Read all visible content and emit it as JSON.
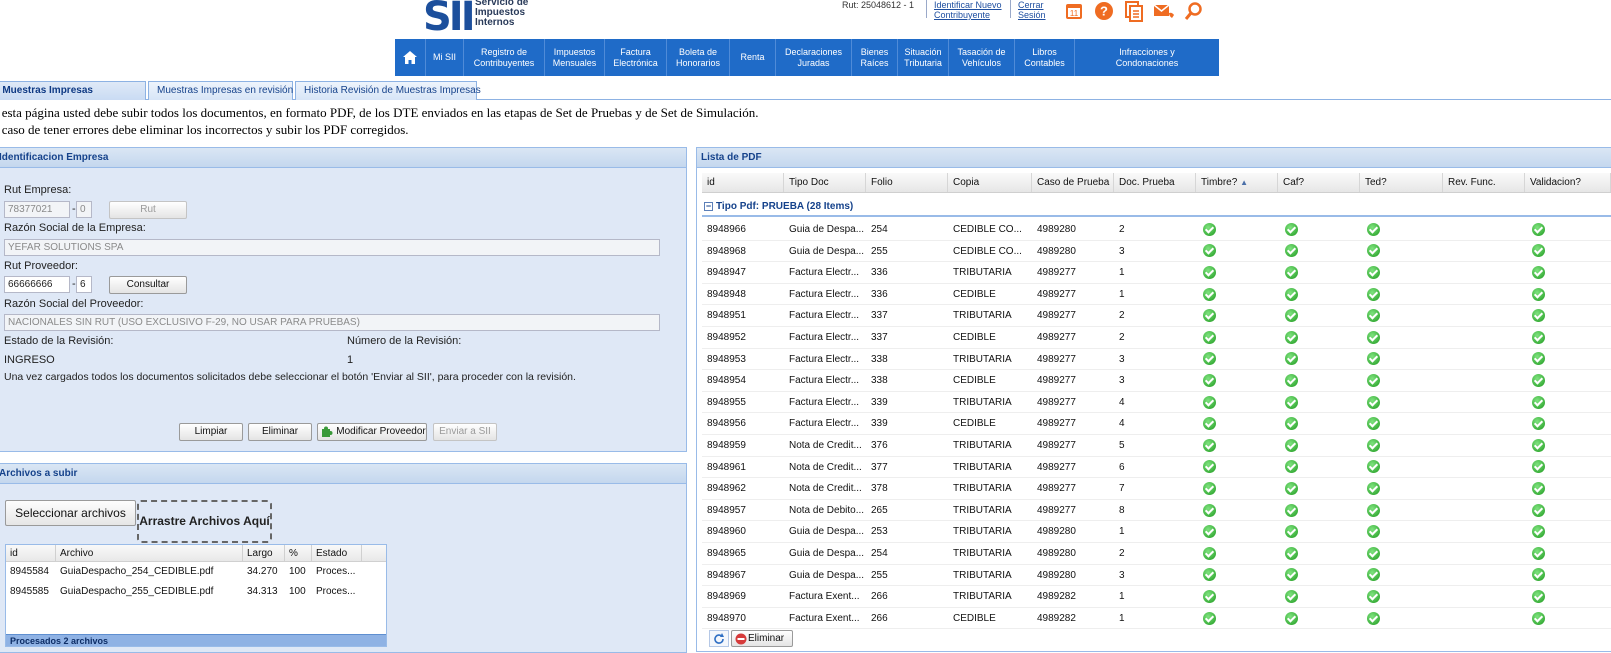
{
  "header": {
    "logo_mark": "SII",
    "logo_text": [
      "Servicio de",
      "Impuestos",
      "Internos"
    ],
    "rut_label": "Rut: 25048612 - 1",
    "link_identificar": [
      "Identificar Nuevo",
      "Contribuyente"
    ],
    "link_cerrar": [
      "Cerrar",
      "Sesión"
    ],
    "calendar_day": "11",
    "icons": [
      "calendar-icon",
      "help-icon",
      "documents-icon",
      "mail-phone-icon",
      "search-icon"
    ]
  },
  "nav": [
    {
      "label": [
        "",
        ""
      ],
      "icon": "home-icon"
    },
    {
      "label": [
        "Mi SII",
        ""
      ]
    },
    {
      "label": [
        "Registro de",
        "Contribuyentes"
      ]
    },
    {
      "label": [
        "Impuestos",
        "Mensuales"
      ]
    },
    {
      "label": [
        "Factura",
        "Electrónica"
      ]
    },
    {
      "label": [
        "Boleta de",
        "Honorarios"
      ]
    },
    {
      "label": [
        "Renta",
        ""
      ]
    },
    {
      "label": [
        "Declaraciones",
        "Juradas"
      ]
    },
    {
      "label": [
        "Bienes",
        "Raíces"
      ]
    },
    {
      "label": [
        "Situación",
        "Tributaria"
      ]
    },
    {
      "label": [
        "Tasación de",
        "Vehículos"
      ]
    },
    {
      "label": [
        "Libros",
        "Contables"
      ]
    },
    {
      "label": [
        "Infracciones y",
        "Condonaciones"
      ]
    }
  ],
  "tabs": [
    {
      "label": "Ingreso de Muestras Impresas",
      "active": true
    },
    {
      "label": "Muestras Impresas en revisión",
      "active": false
    },
    {
      "label": "Historia Revisión de Muestras Impresas",
      "active": false
    }
  ],
  "intro": [
    "En esta página usted debe subir todos los documentos, en formato PDF, de los DTE enviados en las etapas de Set de Pruebas y de Set de Simulación.",
    "En caso de tener errores debe eliminar los incorrectos y subir los PDF corregidos."
  ],
  "empresa_panel": {
    "title": "Identificacion Empresa",
    "rut_empresa_label": "Rut Empresa:",
    "rut_empresa_value": "78377021",
    "rut_empresa_dv": "0",
    "rut_button": "Rut",
    "razon_social_label": "Razón Social de la Empresa:",
    "razon_social_value": "YEFAR SOLUTIONS SPA",
    "rut_proveedor_label": "Rut Proveedor:",
    "rut_proveedor_value": "66666666",
    "rut_proveedor_dv": "6",
    "consultar_button": "Consultar",
    "razon_proveedor_label": "Razón Social del Proveedor:",
    "razon_proveedor_value": "NACIONALES SIN RUT   (USO EXCLUSIVO F-29, NO USAR PARA PRUEBAS)",
    "estado_label": "Estado de la Revisión:",
    "estado_value": "INGRESO",
    "numero_label": "Número de la Revisión:",
    "numero_value": "1",
    "note": "Una vez cargados todos los documentos solicitados debe seleccionar el botón 'Enviar al SII', para proceder con la revisión.",
    "buttons": {
      "limpiar": "Limpiar",
      "eliminar": "Eliminar",
      "modificar": "Modificar Proveedor",
      "enviar": "Enviar a SII"
    }
  },
  "archivos_panel": {
    "title": "Archivos a subir",
    "select_button": "Seleccionar archivos",
    "drop_zone": "Arrastre Archivos Aquí",
    "columns": [
      "id",
      "Archivo",
      "Largo",
      "%",
      "Estado"
    ],
    "rows": [
      [
        "8945584",
        "GuiaDespacho_254_CEDIBLE.pdf",
        "34.270",
        "100",
        "Proces..."
      ],
      [
        "8945585",
        "GuiaDespacho_255_CEDIBLE.pdf",
        "34.313",
        "100",
        "Proces..."
      ]
    ],
    "footer": "Procesados 2 archivos"
  },
  "pdf_panel": {
    "title": "Lista de PDF",
    "columns": [
      "id",
      "Tipo Doc",
      "Folio",
      "Copia",
      "Caso de Prueba",
      "Doc. Prueba",
      "Timbre?",
      "Caf?",
      "Ted?",
      "Rev. Func.",
      "Validacion?"
    ],
    "group": "Tipo Pdf: PRUEBA (28 Items)",
    "rows": [
      [
        "8948966",
        "Guia de Despa...",
        "254",
        "CEDIBLE CO...",
        "4989280",
        "2"
      ],
      [
        "8948968",
        "Guia de Despa...",
        "255",
        "CEDIBLE CO...",
        "4989280",
        "3"
      ],
      [
        "8948947",
        "Factura Electr...",
        "336",
        "TRIBUTARIA",
        "4989277",
        "1"
      ],
      [
        "8948948",
        "Factura Electr...",
        "336",
        "CEDIBLE",
        "4989277",
        "1"
      ],
      [
        "8948951",
        "Factura Electr...",
        "337",
        "TRIBUTARIA",
        "4989277",
        "2"
      ],
      [
        "8948952",
        "Factura Electr...",
        "337",
        "CEDIBLE",
        "4989277",
        "2"
      ],
      [
        "8948953",
        "Factura Electr...",
        "338",
        "TRIBUTARIA",
        "4989277",
        "3"
      ],
      [
        "8948954",
        "Factura Electr...",
        "338",
        "CEDIBLE",
        "4989277",
        "3"
      ],
      [
        "8948955",
        "Factura Electr...",
        "339",
        "TRIBUTARIA",
        "4989277",
        "4"
      ],
      [
        "8948956",
        "Factura Electr...",
        "339",
        "CEDIBLE",
        "4989277",
        "4"
      ],
      [
        "8948959",
        "Nota de Credit...",
        "376",
        "TRIBUTARIA",
        "4989277",
        "5"
      ],
      [
        "8948961",
        "Nota de Credit...",
        "377",
        "TRIBUTARIA",
        "4989277",
        "6"
      ],
      [
        "8948962",
        "Nota de Credit...",
        "378",
        "TRIBUTARIA",
        "4989277",
        "7"
      ],
      [
        "8948957",
        "Nota de Debito...",
        "265",
        "TRIBUTARIA",
        "4989277",
        "8"
      ],
      [
        "8948960",
        "Guia de Despa...",
        "253",
        "TRIBUTARIA",
        "4989280",
        "1"
      ],
      [
        "8948965",
        "Guia de Despa...",
        "254",
        "TRIBUTARIA",
        "4989280",
        "2"
      ],
      [
        "8948967",
        "Guia de Despa...",
        "255",
        "TRIBUTARIA",
        "4989280",
        "3"
      ],
      [
        "8948969",
        "Factura Exent...",
        "266",
        "TRIBUTARIA",
        "4989282",
        "1"
      ],
      [
        "8948970",
        "Factura Exent...",
        "266",
        "CEDIBLE",
        "4989282",
        "1"
      ]
    ],
    "footer_eliminar": "Eliminar"
  },
  "colors": {
    "nav": "#1f6bc8",
    "panel": "#dfe8f6",
    "border": "#99bbe8",
    "check": "#1f9a1f",
    "accent": "#ef6c22"
  }
}
